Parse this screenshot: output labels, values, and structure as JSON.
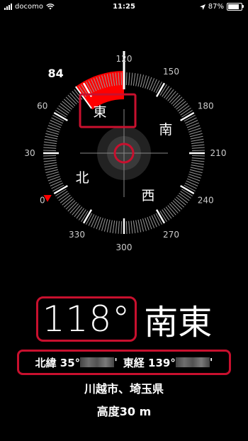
{
  "status_bar": {
    "carrier": "docomo",
    "time": "11:25",
    "battery": "87%",
    "battery_level": 0.87,
    "icons": [
      "signal-icon",
      "wifi-icon",
      "location-arrow-icon",
      "battery-icon"
    ]
  },
  "compass": {
    "target_bearing": "84",
    "bearing_labels": [
      {
        "text": "120",
        "deg": 0
      },
      {
        "text": "150",
        "deg": 30
      },
      {
        "text": "180",
        "deg": 60
      },
      {
        "text": "210",
        "deg": 90
      },
      {
        "text": "240",
        "deg": 120
      },
      {
        "text": "270",
        "deg": 150
      },
      {
        "text": "300",
        "deg": 180
      },
      {
        "text": "330",
        "deg": 210
      },
      {
        "text": "0",
        "deg": 240
      },
      {
        "text": "30",
        "deg": 270
      },
      {
        "text": "60",
        "deg": 300
      }
    ],
    "cardinal_labels": [
      {
        "text": "東",
        "deg": -30
      },
      {
        "text": "南",
        "deg": 60
      },
      {
        "text": "西",
        "deg": 150
      },
      {
        "text": "北",
        "deg": 240
      }
    ],
    "accent_color": "#ff0000",
    "highlight_color": "#c8102e"
  },
  "heading": {
    "degrees": "118°",
    "direction": "南東"
  },
  "coordinates": {
    "lat_label": "北緯 35°",
    "lat_suffix": "'",
    "lon_label": "東経 139°",
    "lon_suffix": "'"
  },
  "location": {
    "place": "川越市、埼玉県",
    "altitude": "高度30 m"
  }
}
